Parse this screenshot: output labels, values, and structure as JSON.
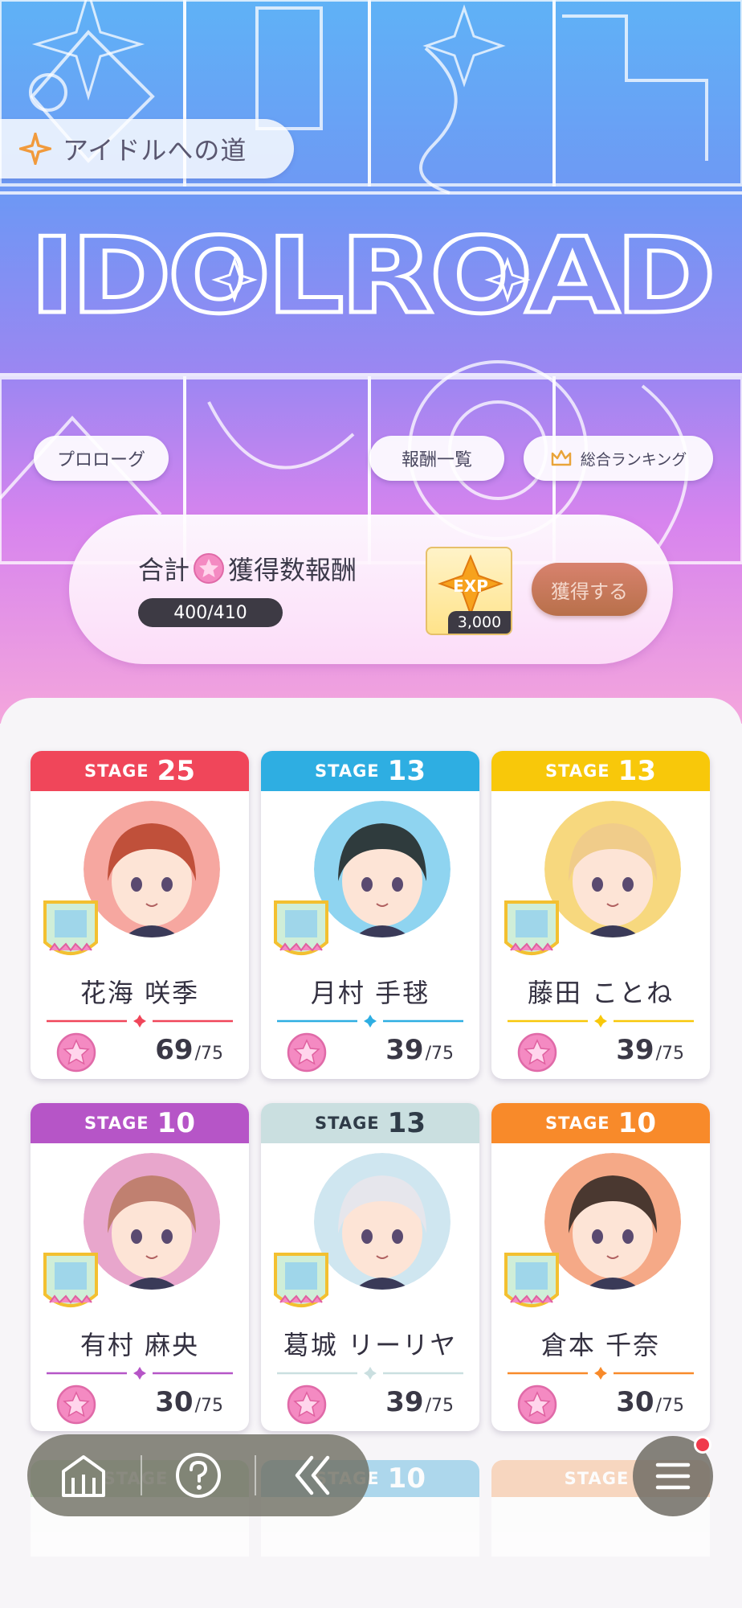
{
  "header": {
    "section_title": "アイドルへの道",
    "logo_text": "IDOLROAD"
  },
  "chips": {
    "prologue": "プロローグ",
    "rewards": "報酬一覧",
    "ranking": "総合ランキング"
  },
  "reward_panel": {
    "label_prefix": "合計",
    "label_suffix": "獲得数報酬",
    "progress": "400/410",
    "item_name": "EXP",
    "item_count": "3,000",
    "claim_label": "獲得する"
  },
  "idols": [
    {
      "stage_label": "STAGE",
      "stage": "25",
      "name": "花海 咲季",
      "count": "69",
      "max": "/75",
      "color": "#f0465a",
      "skin": "#f6a7a0",
      "hair": "#c0503a"
    },
    {
      "stage_label": "STAGE",
      "stage": "13",
      "name": "月村 手毬",
      "count": "39",
      "max": "/75",
      "color": "#2eaee2",
      "skin": "#8fd4f0",
      "hair": "#2f3b3d"
    },
    {
      "stage_label": "STAGE",
      "stage": "13",
      "name": "藤田 ことね",
      "count": "39",
      "max": "/75",
      "color": "#f8c80a",
      "skin": "#f7d87e",
      "hair": "#f0cc8a"
    },
    {
      "stage_label": "STAGE",
      "stage": "10",
      "name": "有村 麻央",
      "count": "30",
      "max": "/75",
      "color": "#b655c7",
      "skin": "#e8a6cc",
      "hair": "#c08070"
    },
    {
      "stage_label": "STAGE",
      "stage": "13",
      "name": "葛城 リーリヤ",
      "count": "39",
      "max": "/75",
      "color": "#cadfe0",
      "text_color": "#2f3b48",
      "skin": "#cfe6f0",
      "hair": "#e6e6ec"
    },
    {
      "stage_label": "STAGE",
      "stage": "10",
      "name": "倉本 千奈",
      "count": "30",
      "max": "/75",
      "color": "#f88a2a",
      "skin": "#f5a987",
      "hair": "#4a3830"
    }
  ],
  "partial_row": [
    {
      "stage": "",
      "color": "#b9ddb0"
    },
    {
      "stage": "10",
      "color": "#8ecbe8"
    },
    {
      "stage": "",
      "color": "#f8c9a8"
    }
  ],
  "nav": {
    "home_icon": "home-icon",
    "help_icon": "help-icon",
    "back_icon": "back-icon",
    "menu_icon": "menu-icon"
  }
}
